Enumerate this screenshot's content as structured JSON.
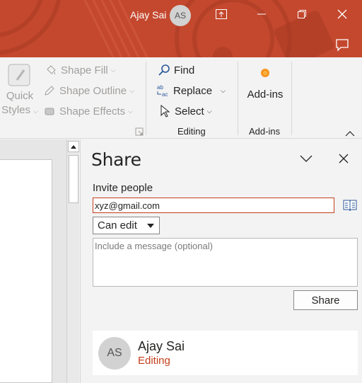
{
  "titlebar": {
    "user_name": "Ajay Sai",
    "user_initials": "AS",
    "accent_color": "#c4482e"
  },
  "ribbon": {
    "quick_styles": {
      "line1": "Quick",
      "line2": "Styles"
    },
    "shape_fill": "Shape Fill",
    "shape_outline": "Shape Outline",
    "shape_effects": "Shape Effects",
    "find": "Find",
    "replace": "Replace",
    "select": "Select",
    "editing_group": "Editing",
    "addins_button": "Add-ins",
    "addins_group": "Add-ins"
  },
  "share": {
    "title": "Share",
    "invite_label": "Invite people",
    "email_value": "xyz@gmail.com",
    "permission": "Can edit",
    "message_placeholder": "Include a message (optional)",
    "share_button": "Share",
    "person": {
      "initials": "AS",
      "name": "Ajay Sai",
      "role": "Editing"
    }
  }
}
